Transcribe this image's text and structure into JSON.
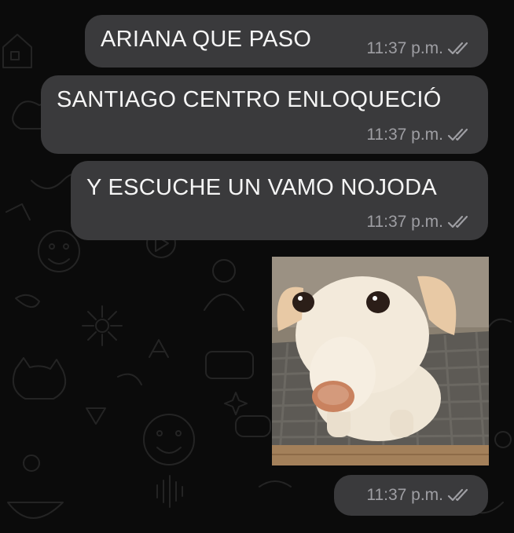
{
  "chat": {
    "messages": [
      {
        "text": "ARIANA QUE PASO",
        "time": "11:37 p.m.",
        "status_icon": "double-check-icon"
      },
      {
        "text": "SANTIAGO CENTRO ENLOQUECIÓ",
        "time": "11:37 p.m.",
        "status_icon": "double-check-icon"
      },
      {
        "text": "Y ESCUCHE UN VAMO NOJODA",
        "time": "11:37 p.m.",
        "status_icon": "double-check-icon"
      },
      {
        "type": "image",
        "image_subject": "dog-photo",
        "time": "11:37 p.m.",
        "status_icon": "double-check-icon"
      }
    ]
  },
  "colors": {
    "background": "#0b0b0b",
    "bubble": "#3a3a3c",
    "text": "#f5f5f5",
    "meta": "#9e9ea3"
  }
}
